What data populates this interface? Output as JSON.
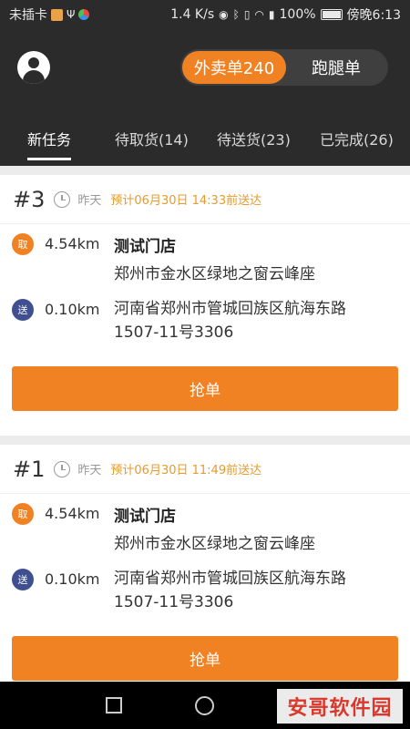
{
  "status_bar": {
    "carrier": "未插卡",
    "speed": "1.4 K/s",
    "battery": "100%",
    "time": "傍晚6:13"
  },
  "header": {
    "switch": {
      "active": "外卖单240",
      "inactive": "跑腿单"
    }
  },
  "tabs": [
    {
      "label": "新任务"
    },
    {
      "label": "待取货(14)"
    },
    {
      "label": "待送货(23)"
    },
    {
      "label": "已完成(26)"
    }
  ],
  "orders": [
    {
      "no": "#3",
      "day": "昨天",
      "eta": "预计06月30日 14:33前送达",
      "pickup": {
        "badge": "取",
        "distance": "4.54km",
        "store": "测试门店",
        "address": "郑州市金水区绿地之窗云峰座"
      },
      "delivery": {
        "badge": "送",
        "distance": "0.10km",
        "address_line1": "河南省郑州市管城回族区航海东路",
        "address_line2": "1507-11号3306"
      },
      "button": "抢单"
    },
    {
      "no": "#1",
      "day": "昨天",
      "eta": "预计06月30日 11:49前送达",
      "pickup": {
        "badge": "取",
        "distance": "4.54km",
        "store": "测试门店",
        "address": "郑州市金水区绿地之窗云峰座"
      },
      "delivery": {
        "badge": "送",
        "distance": "0.10km",
        "address_line1": "河南省郑州市管城回族区航海东路",
        "address_line2": "1507-11号3306"
      },
      "button": "抢单"
    }
  ],
  "watermark": "安哥软件园",
  "colors": {
    "accent": "#f18224",
    "header_bg": "#2b2b2b",
    "deliver_badge": "#3f4f90",
    "eta_text": "#e89a2e"
  }
}
